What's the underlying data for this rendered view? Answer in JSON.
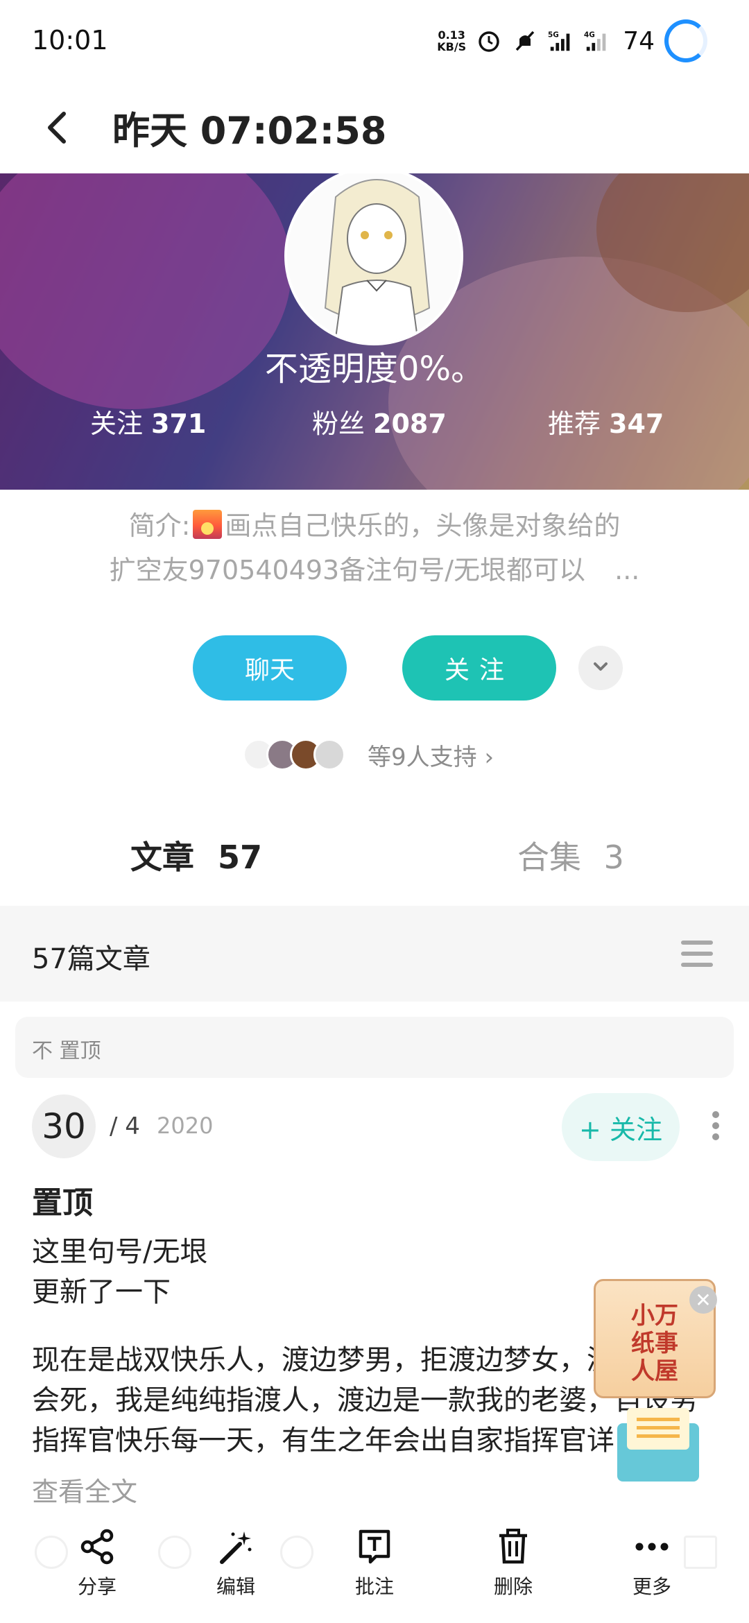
{
  "status_bar": {
    "time": "10:01",
    "net_speed_value": "0.13",
    "net_speed_unit": "KB/S",
    "battery": "74",
    "icons": [
      "alarm-icon",
      "mute-icon",
      "signal-5g-icon",
      "signal-4g-icon",
      "battery-ring-icon"
    ]
  },
  "header": {
    "title": "昨天 07:02:58"
  },
  "profile": {
    "nickname": "不透明度0%。",
    "stats": [
      {
        "label": "关注",
        "value": "371"
      },
      {
        "label": "粉丝",
        "value": "2087"
      },
      {
        "label": "推荐",
        "value": "347"
      }
    ],
    "bio_prefix": "简介:",
    "bio_line1_rest": "画点自己快乐的，头像是对象给的",
    "bio_line2": "扩空友970540493备注句号/无垠都可以",
    "bio_more": "..."
  },
  "actions": {
    "chat": "聊天",
    "follow": "关注"
  },
  "supporters": {
    "text": "等9人支持 ›"
  },
  "tabs": {
    "articles_label": "文章",
    "articles_count": "57",
    "collections_label": "合集",
    "collections_count": "3"
  },
  "section": {
    "title": "57篇文章"
  },
  "pinned": {
    "label": "不 置顶"
  },
  "post": {
    "day": "30",
    "month": "/ 4",
    "year": "2020",
    "follow": "+ 关注",
    "title": "置顶",
    "line1": "这里句号/无垠",
    "line2": "更新了一下",
    "paragraph": "现在是战双快乐人，渡边梦男，拒渡边梦女，渡女指就会死，我是纯纯指渡人，渡边是一款我的老婆，自设男指挥官快乐每一天，有生之年会出自家指挥官详",
    "read_more": "查看全文"
  },
  "floating_ad": {
    "text_line1": "小万",
    "text_line2": "纸事",
    "text_line3": "人屋"
  },
  "bottom_bar": {
    "share": "分享",
    "edit": "编辑",
    "annotate": "批注",
    "delete": "删除",
    "more": "更多"
  },
  "colors": {
    "chat_button": "#2fbde6",
    "follow_button": "#1ec3b4",
    "follow_text": "#18b9a9",
    "battery_ring": "#1e90ff"
  }
}
